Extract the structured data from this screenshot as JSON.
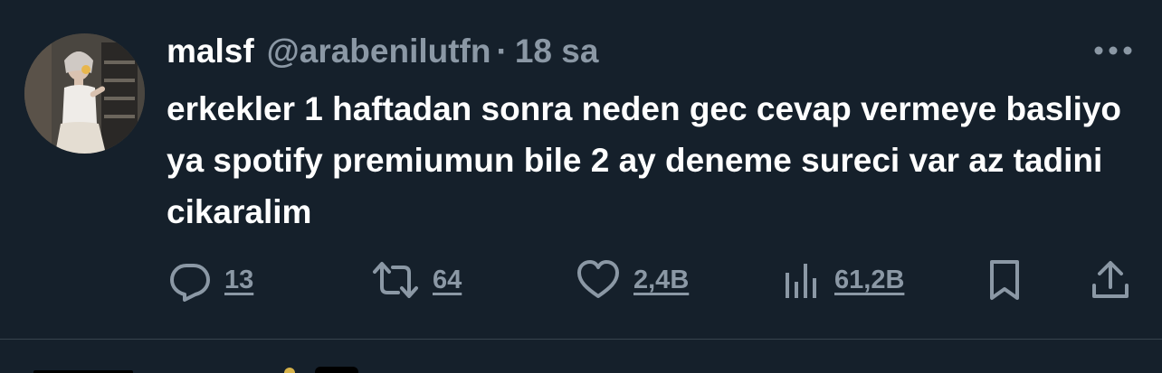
{
  "tweet": {
    "author": {
      "display_name": "malsf",
      "handle": "@arabenilutfn",
      "separator": "·",
      "timestamp": "18 sa"
    },
    "text": "erkekler 1 haftadan sonra neden gec cevap vermeye basliyo ya spotify premiumun bile 2 ay deneme sureci var az tadini cikaralim",
    "actions": {
      "reply": {
        "icon": "reply-icon",
        "count": "13"
      },
      "retweet": {
        "icon": "retweet-icon",
        "count": "64"
      },
      "like": {
        "icon": "heart-icon",
        "count": "2,4B"
      },
      "views": {
        "icon": "analytics-icon",
        "count": "61,2B"
      },
      "bookmark": {
        "icon": "bookmark-icon"
      },
      "share": {
        "icon": "share-icon"
      }
    },
    "more_icon": "more-horizontal-icon"
  },
  "colors": {
    "background": "#15202b",
    "primary_text": "#ffffff",
    "secondary_text": "#8b98a5",
    "divider": "#38444d"
  }
}
